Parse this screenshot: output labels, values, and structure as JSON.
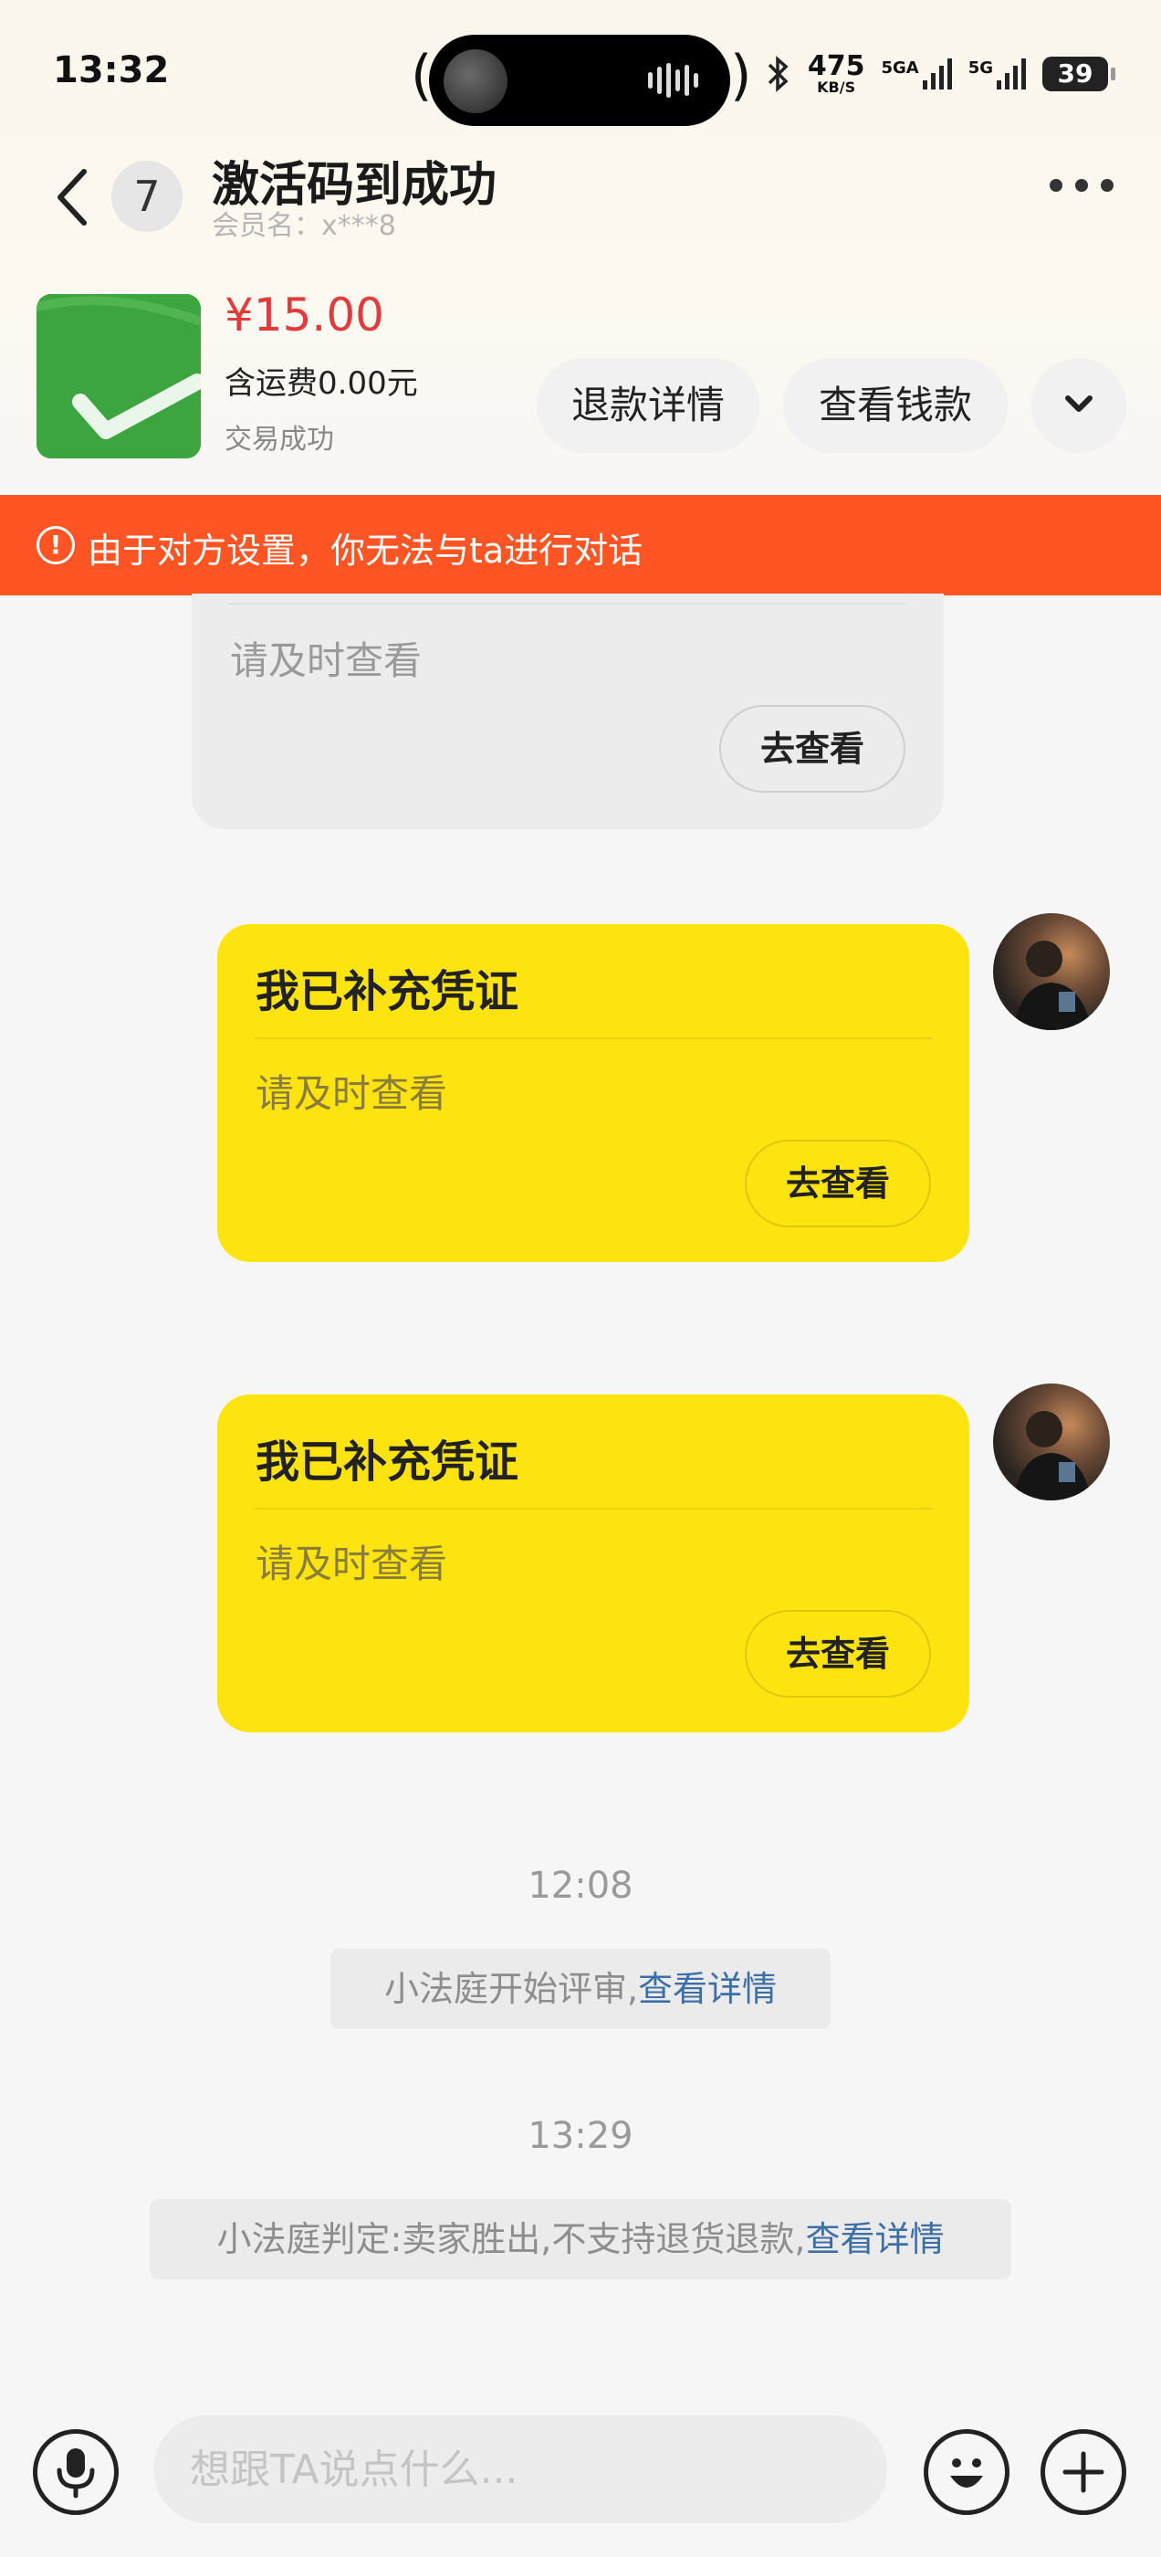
{
  "status_bar": {
    "time": "13:32",
    "net_speed": "475",
    "net_speed_unit": "KB/S",
    "signal1": "5GA",
    "signal2": "5G",
    "battery": "39"
  },
  "header": {
    "unread_count": "7",
    "title": "激活码到成功",
    "subtitle": "会员名：x***8"
  },
  "order": {
    "price": "¥15.00",
    "shipping": "含运费0.00元",
    "status": "交易成功",
    "refund_button": "退款详情",
    "view_money_button": "查看钱款"
  },
  "alert": {
    "text": "由于对方设置，你无法与ta进行对话"
  },
  "messages": [
    {
      "body": "请及时查看",
      "button": "去查看"
    },
    {
      "title": "我已补充凭证",
      "body": "请及时查看",
      "button": "去查看"
    },
    {
      "title": "我已补充凭证",
      "body": "请及时查看",
      "button": "去查看"
    }
  ],
  "system": [
    {
      "time": "12:08",
      "text": "小法庭开始评审,",
      "link": "查看详情"
    },
    {
      "time": "13:29",
      "text": "小法庭判定:卖家胜出,不支持退货退款,",
      "link": "查看详情"
    }
  ],
  "input": {
    "placeholder": "想跟TA说点什么..."
  },
  "colors": {
    "alert_bg": "#ff5524",
    "bubble_yellow": "#fde410",
    "price_red": "#e23b3b",
    "link_blue": "#3c6fa8"
  },
  "icons": [
    "back-icon",
    "more-icon",
    "chevron-down-icon",
    "alert-icon",
    "microphone-icon",
    "emoji-icon",
    "plus-icon"
  ]
}
